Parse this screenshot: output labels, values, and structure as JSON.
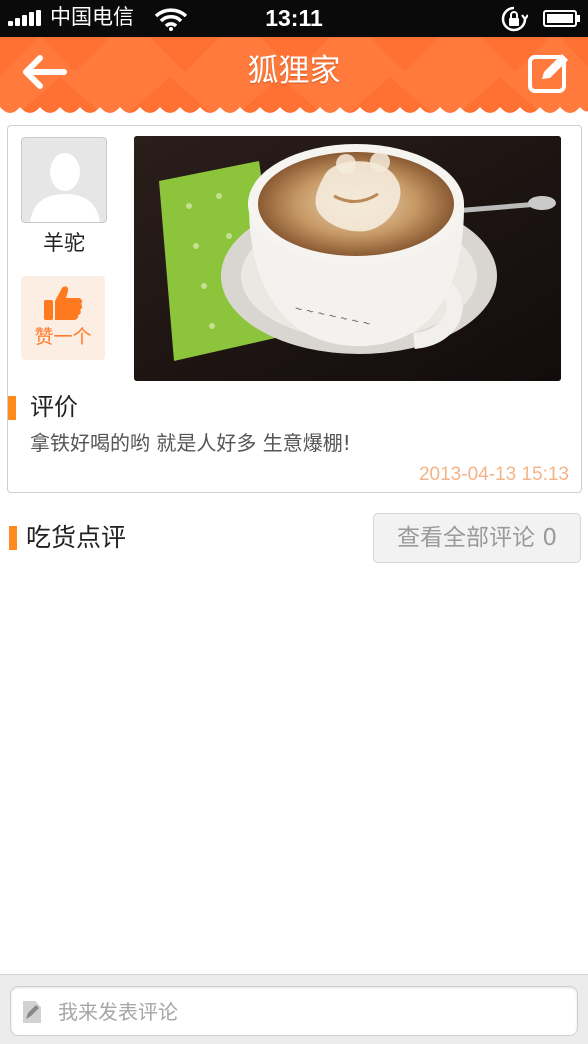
{
  "status_bar": {
    "carrier": "中国电信",
    "time": "13:11",
    "icons": [
      "signal-icon",
      "wifi-icon",
      "rotation-lock-icon",
      "battery-icon"
    ]
  },
  "nav": {
    "title": "狐狸家",
    "back_icon": "back-arrow-icon",
    "compose_icon": "edit-icon"
  },
  "post": {
    "user_name": "羊驼",
    "like_label": "赞一个",
    "photo": "latte-art-coffee-photo",
    "review_heading": "评价",
    "review_text": "拿铁好喝的哟 就是人好多 生意爆棚!",
    "date": "2013-04-13 15:13"
  },
  "comments_section": {
    "heading": "吃货点评",
    "view_all_label": "查看全部评论 0"
  },
  "bottom": {
    "placeholder": "我来发表评论"
  },
  "colors": {
    "accent": "#ff7a3c",
    "marker": "#ff8a1e",
    "date": "#f4b487"
  }
}
